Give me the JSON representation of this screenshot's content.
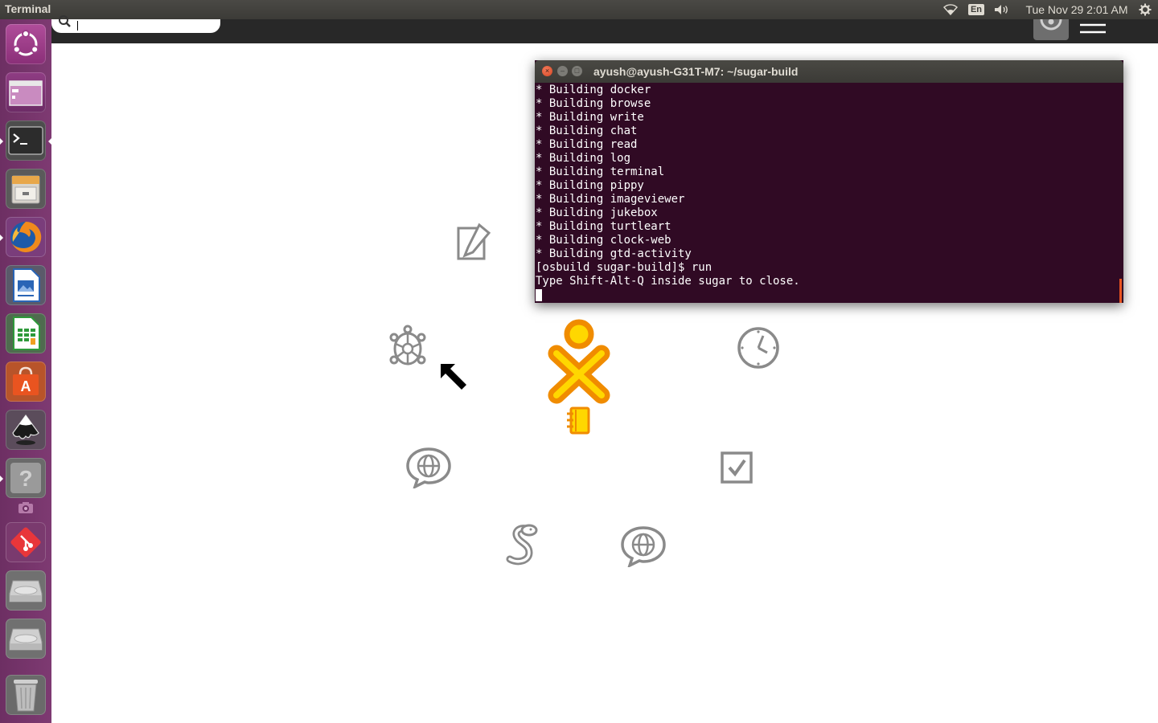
{
  "top_panel": {
    "app_title": "Terminal",
    "keyboard_layout": "En",
    "clock": "Tue Nov 29  2:01 AM",
    "icons": [
      "wifi-icon",
      "volume-icon",
      "session-gear-icon"
    ]
  },
  "launcher": {
    "items": [
      {
        "name": "ubuntu-dash",
        "icon": "ubuntu-logo-icon"
      },
      {
        "name": "sugar-window",
        "icon": "window-icon"
      },
      {
        "name": "terminal",
        "icon": "terminal-icon"
      },
      {
        "name": "files",
        "icon": "file-cabinet-icon"
      },
      {
        "name": "firefox",
        "icon": "firefox-icon"
      },
      {
        "name": "writer",
        "icon": "libreoffice-writer-icon"
      },
      {
        "name": "calc",
        "icon": "libreoffice-calc-icon"
      },
      {
        "name": "software-center",
        "icon": "software-center-icon"
      },
      {
        "name": "inkscape",
        "icon": "inkscape-icon"
      },
      {
        "name": "help",
        "icon": "question-icon"
      },
      {
        "name": "screenshot",
        "icon": "camera-icon"
      },
      {
        "name": "git",
        "icon": "git-icon"
      },
      {
        "name": "drive-1",
        "icon": "hard-drive-icon"
      },
      {
        "name": "drive-2",
        "icon": "hard-drive-icon"
      },
      {
        "name": "trash",
        "icon": "trash-icon"
      }
    ]
  },
  "terminal": {
    "title": "ayush@ayush-G31T-M7: ~/sugar-build",
    "close_glyph": "×",
    "minimize_glyph": "–",
    "maximize_glyph": "□",
    "lines": [
      "* Building docker",
      "* Building browse",
      "* Building write",
      "* Building chat",
      "* Building read",
      "* Building log",
      "* Building terminal",
      "* Building pippy",
      "* Building imageviewer",
      "* Building jukebox",
      "* Building turtleart",
      "* Building clock-web",
      "* Building gtd-activity",
      "[osbuild sugar-build]$ run",
      "Type Shift-Alt-Q inside sugar to close."
    ]
  },
  "sugar_home": {
    "xo_colors": {
      "stroke": "#f08c00",
      "fill": "#ffd700"
    },
    "activities": [
      {
        "name": "write",
        "icon": "write-pencil-icon"
      },
      {
        "name": "turtleart",
        "icon": "turtle-icon"
      },
      {
        "name": "clock",
        "icon": "clock-icon"
      },
      {
        "name": "journal",
        "icon": "journal-icon"
      },
      {
        "name": "chat",
        "icon": "chat-globe-icon"
      },
      {
        "name": "gtd",
        "icon": "checkbox-icon"
      },
      {
        "name": "pippy",
        "icon": "snake-icon"
      },
      {
        "name": "browse",
        "icon": "browse-globe-icon"
      }
    ]
  },
  "colors": {
    "launcher": "#7e3a72",
    "terminal_bg": "#300a24",
    "panel": "#3c3b37",
    "icon_gray": "#8a8a8a"
  }
}
